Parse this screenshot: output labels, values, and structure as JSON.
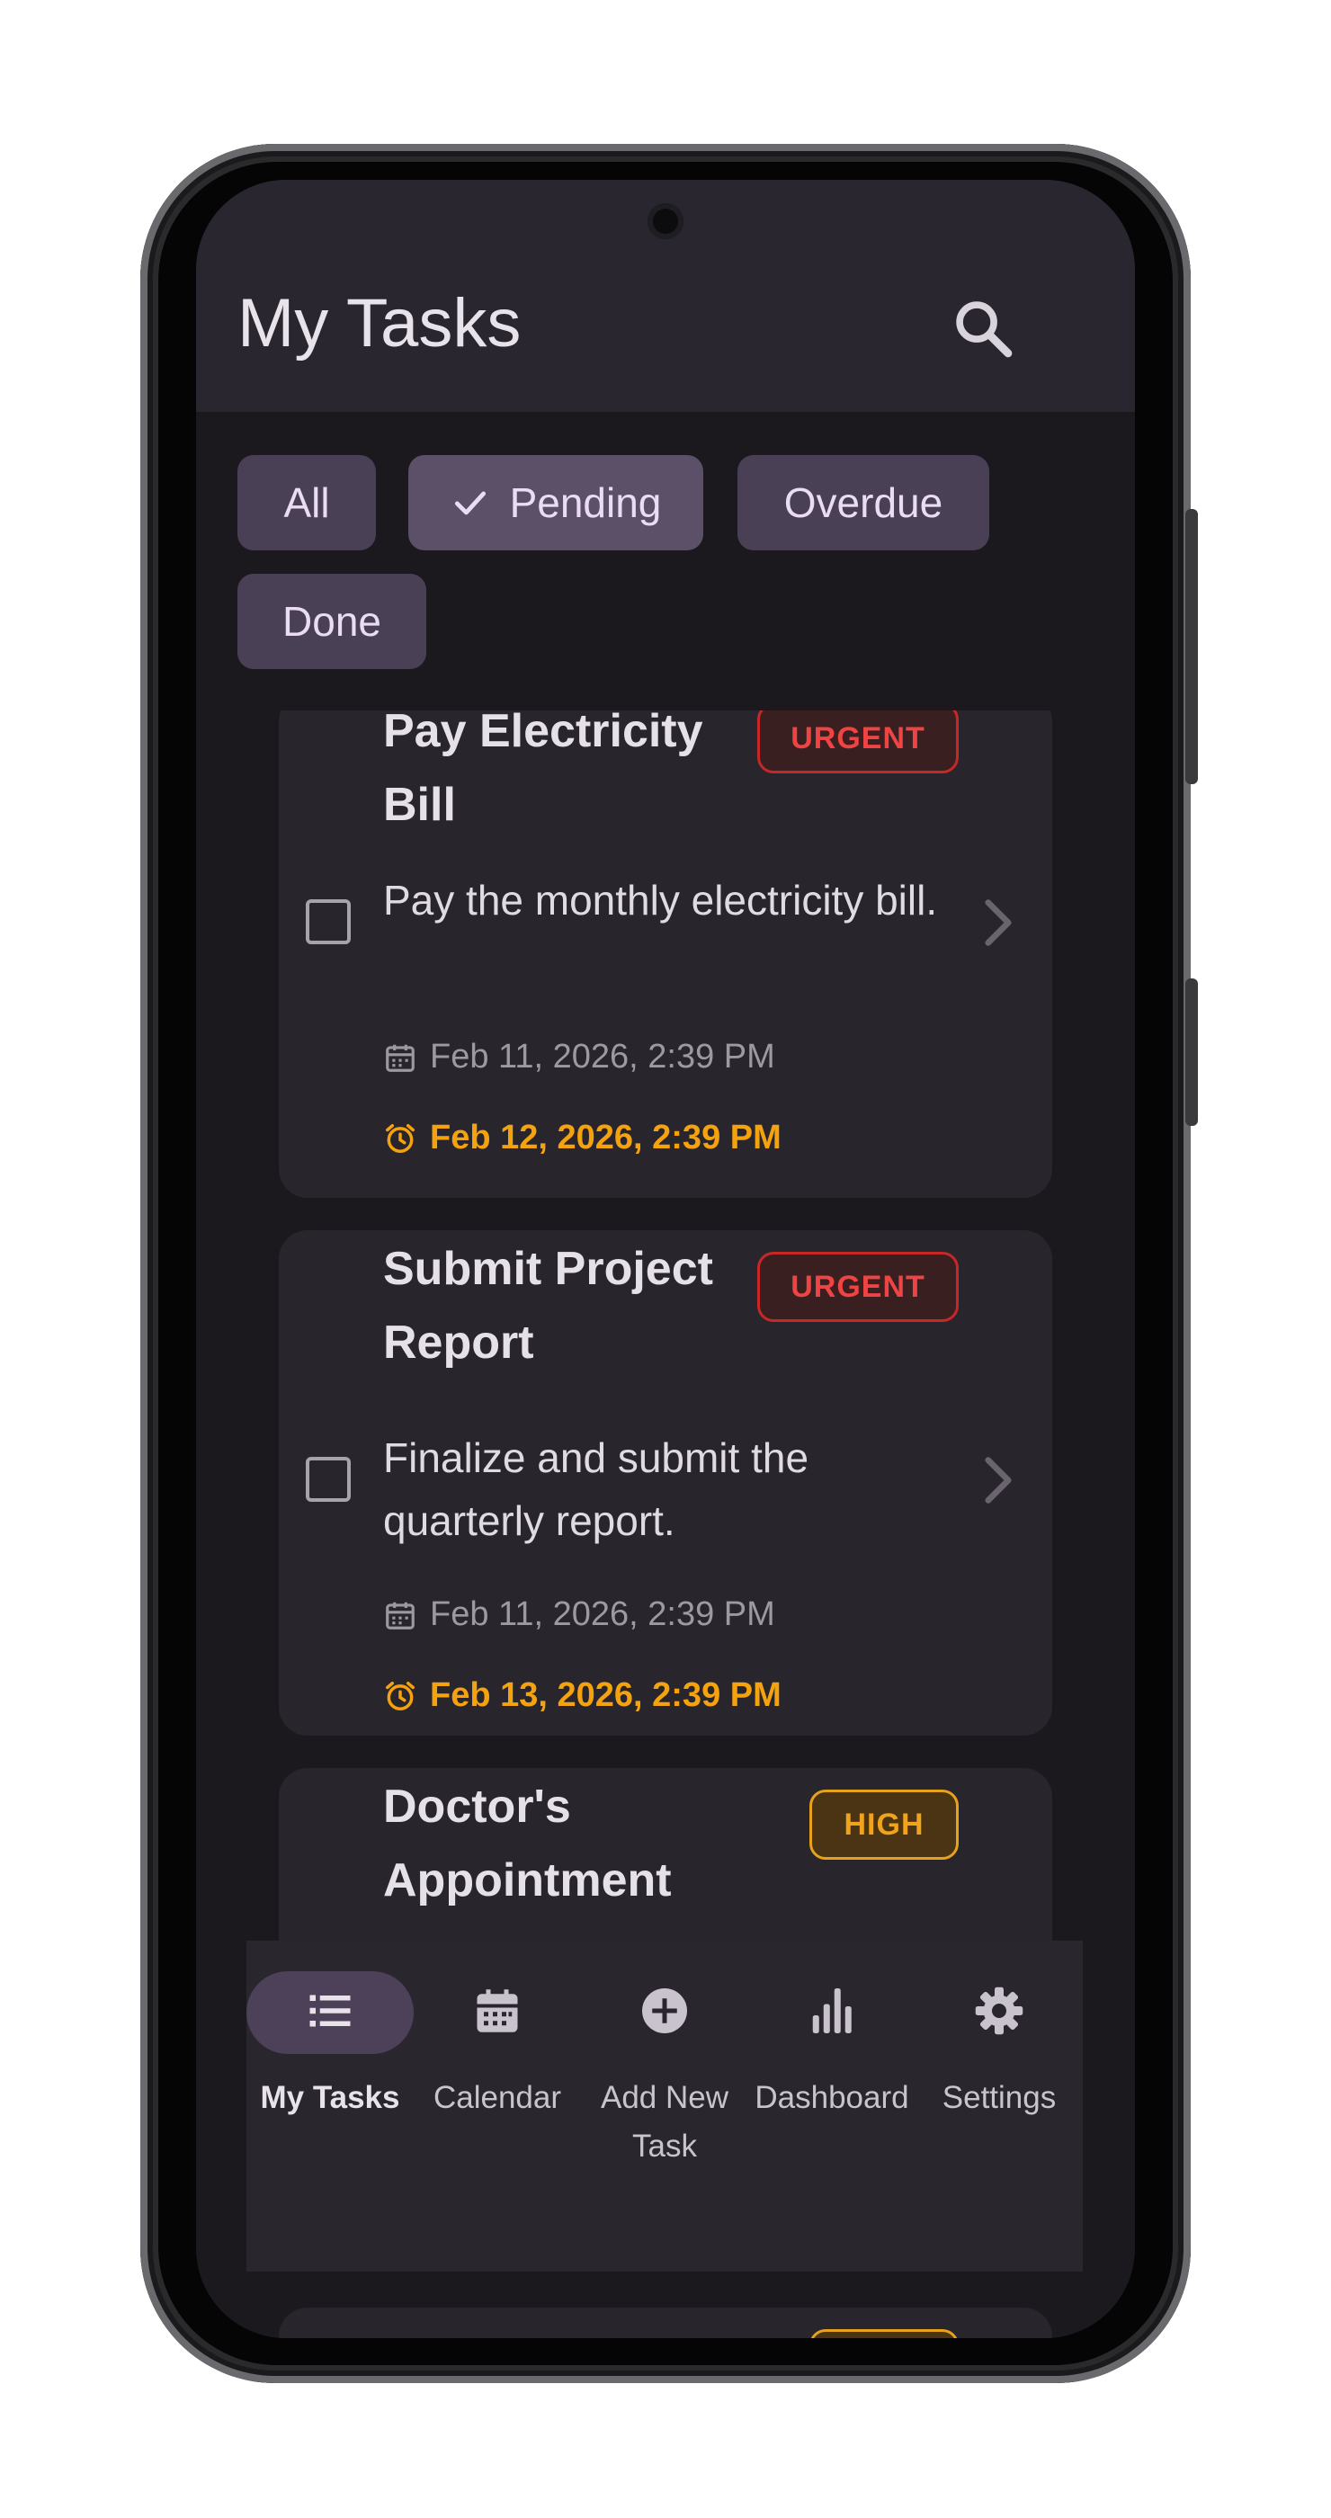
{
  "app": {
    "title": "My Tasks"
  },
  "filters": [
    {
      "label": "All",
      "selected": false
    },
    {
      "label": "Pending",
      "selected": true
    },
    {
      "label": "Overdue",
      "selected": false
    },
    {
      "label": "Done",
      "selected": false
    }
  ],
  "tasks": [
    {
      "title": "Pay Electricity Bill",
      "priority": "URGENT",
      "description": "Pay the monthly electricity bill.",
      "created": "Feb 11, 2026, 2:39 PM",
      "due": "Feb 12, 2026, 2:39 PM",
      "done": false
    },
    {
      "title": "Submit Project Report",
      "priority": "URGENT",
      "description": "Finalize and submit the quarterly report.",
      "created": "Feb 11, 2026, 2:39 PM",
      "due": "Feb 13, 2026, 2:39 PM",
      "done": false
    },
    {
      "title": "Doctor's Appointment",
      "priority": "HIGH"
    }
  ],
  "bottom_nav": [
    {
      "label": "My Tasks",
      "icon": "list-icon",
      "active": true
    },
    {
      "label": "Calendar",
      "icon": "calendar-icon",
      "active": false
    },
    {
      "label": "Add New Task",
      "icon": "add-circle-icon",
      "active": false
    },
    {
      "label": "Dashboard",
      "icon": "bar-chart-icon",
      "active": false
    },
    {
      "label": "Settings",
      "icon": "gear-icon",
      "active": false
    }
  ],
  "colors": {
    "background": "#1b191d",
    "surface": "#28252c",
    "chip": "#4a4056",
    "urgent": "#ef4444",
    "high": "#f0a31c",
    "due": "#f5a20f"
  }
}
